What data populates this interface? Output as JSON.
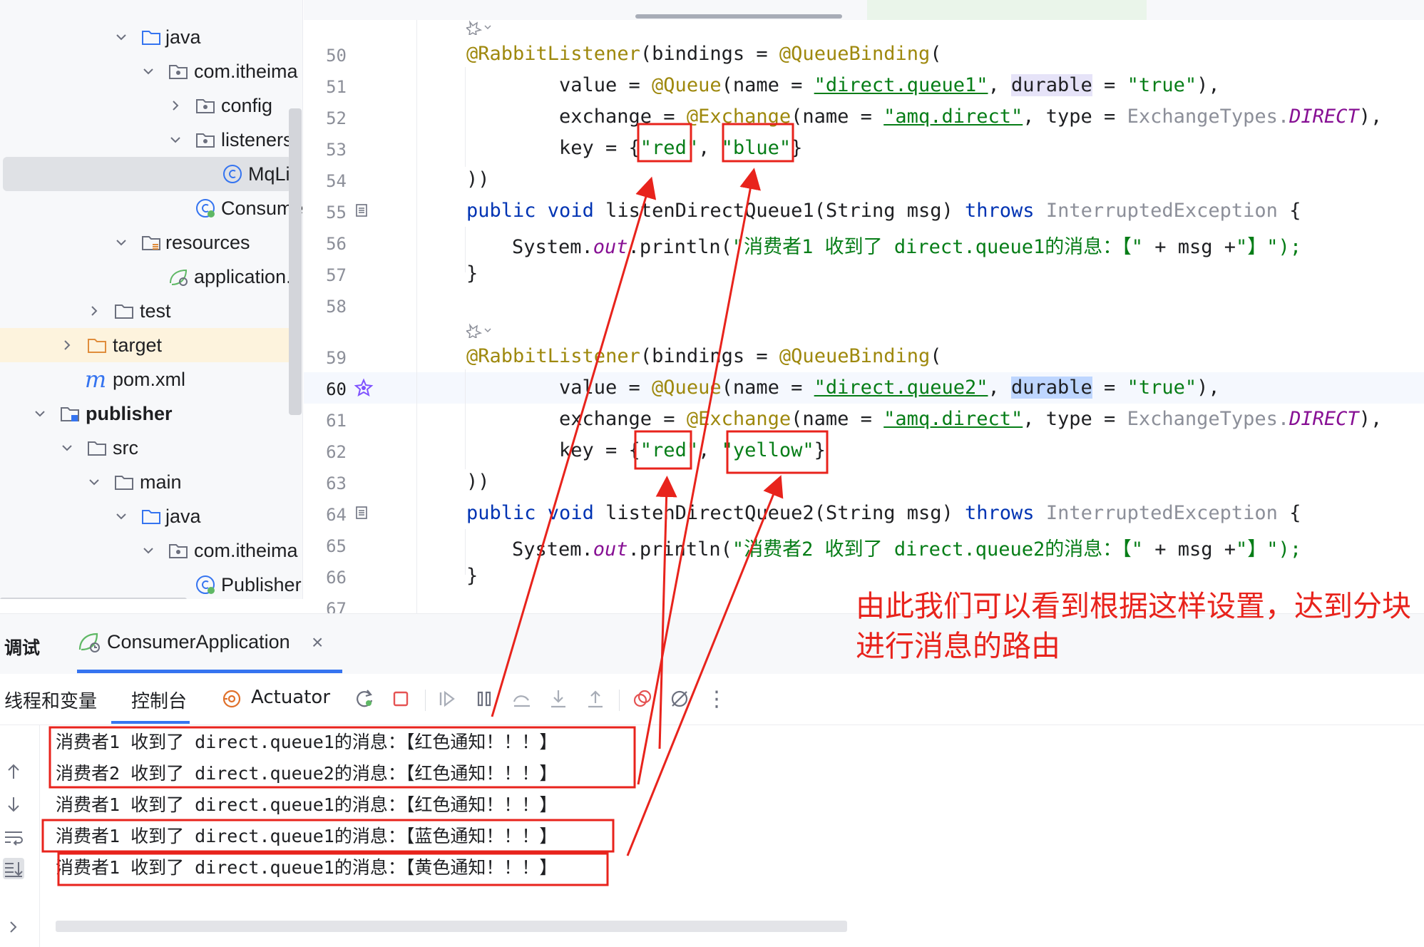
{
  "tree": {
    "items": [
      {
        "label": "java",
        "icon": "folder-icon",
        "chevron": "down"
      },
      {
        "label": "com.itheima",
        "icon": "package-icon",
        "chevron": "down"
      },
      {
        "label": "config",
        "icon": "package-icon",
        "chevron": "right"
      },
      {
        "label": "listeners",
        "icon": "package-icon",
        "chevron": "down"
      },
      {
        "label": "MqLis",
        "icon": "class-icon",
        "chevron": ""
      },
      {
        "label": "Consume",
        "icon": "spring-class-icon",
        "chevron": ""
      },
      {
        "label": "resources",
        "icon": "resources-folder-icon",
        "chevron": "down"
      },
      {
        "label": "application.y",
        "icon": "spring-config-icon",
        "chevron": ""
      },
      {
        "label": "test",
        "icon": "folder-icon",
        "chevron": "right"
      },
      {
        "label": "target",
        "icon": "excluded-folder-icon",
        "chevron": "right"
      },
      {
        "label": "pom.xml",
        "icon": "maven-icon",
        "chevron": ""
      },
      {
        "label": "publisher",
        "icon": "module-icon",
        "chevron": "down"
      },
      {
        "label": "src",
        "icon": "folder-icon",
        "chevron": "down"
      },
      {
        "label": "main",
        "icon": "folder-icon",
        "chevron": "down"
      },
      {
        "label": "java",
        "icon": "folder-icon",
        "chevron": "down"
      },
      {
        "label": "com.itheima",
        "icon": "package-icon",
        "chevron": "down"
      },
      {
        "label": "Publisher",
        "icon": "spring-class-icon",
        "chevron": ""
      }
    ],
    "maven_glyph": "m"
  },
  "editor": {
    "lines": [
      {
        "n": "50"
      },
      {
        "n": "51"
      },
      {
        "n": "52"
      },
      {
        "n": "53"
      },
      {
        "n": "54"
      },
      {
        "n": "55"
      },
      {
        "n": "56"
      },
      {
        "n": "57"
      },
      {
        "n": "58"
      },
      {
        "n": "59"
      },
      {
        "n": "60"
      },
      {
        "n": "61"
      },
      {
        "n": "62"
      },
      {
        "n": "63"
      },
      {
        "n": "64"
      },
      {
        "n": "65"
      },
      {
        "n": "66"
      },
      {
        "n": "67"
      }
    ],
    "t": {
      "rl": "@RabbitListener",
      "bindings": "(bindings = ",
      "qb": "@QueueBinding",
      "open": "(",
      "value": "value = ",
      "queue_ann": "@Queue",
      "name_eq": "(name = ",
      "q1": "\"direct.queue1\"",
      "q2": "\"direct.queue2\"",
      "comma": ", ",
      "durable": "durable",
      "eq": " = ",
      "true_str": "\"true\"",
      "close_comma": "),",
      "exchange": "exchange = ",
      "ex_ann": "@Exchange",
      "amq": "\"amq.direct\"",
      "type_eq": ", type = ",
      "ex_types": "ExchangeTypes.",
      "direct": "DIRECT",
      "key": "key = {",
      "red": "\"red\"",
      "blue": "\"blue\"",
      "yellow": "\"yellow\"",
      "brace": "}",
      "close": "))",
      "pub": "public",
      "void": " void ",
      "m1": "listenDirectQueue1",
      "m2": "listenDirectQueue2",
      "sig": "(String msg) ",
      "throws": "throws",
      "exc": " InterruptedException ",
      "obrace": "{",
      "sys": "System.",
      "out": "out",
      "println": ".println(",
      "msg1": "\"消费者1 收到了 direct.queue1的消息：【\"",
      "msg2": "\"消费者2 收到了 direct.queue2的消息：【\"",
      "plus": " + msg +",
      "end": "\"】\");",
      "cbrace": "}"
    }
  },
  "debug": {
    "title": "调试",
    "run_config": "ConsumerApplication",
    "close": "×",
    "tabs": {
      "threads": "线程和变量",
      "console": "控制台",
      "actuator": "Actuator"
    },
    "more": "⋮",
    "console_lines": [
      "消费者1 收到了 direct.queue1的消息：【红色通知！！！】",
      "消费者2 收到了 direct.queue2的消息：【红色通知！！！】",
      "消费者1 收到了 direct.queue1的消息：【红色通知！！！】",
      "消费者1 收到了 direct.queue1的消息：【蓝色通知！！！】",
      "消费者1 收到了 direct.queue1的消息：【黄色通知！！！】"
    ]
  },
  "annotation": {
    "caption": "由此我们可以看到根据这样设置，达到分块进行消息的路由",
    "color": "#e8231c"
  },
  "colors": {
    "accent": "#3574f0",
    "annotation_red": "#e8231c",
    "string_green": "#067d17",
    "keyword_blue": "#0033b3",
    "annotation_olive": "#9e880d"
  }
}
